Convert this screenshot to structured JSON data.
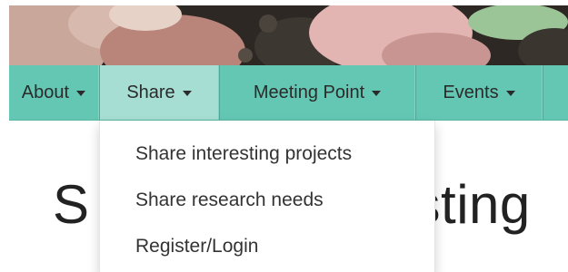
{
  "nav": {
    "items": [
      {
        "label": "About",
        "has_caret": true
      },
      {
        "label": "Share",
        "has_caret": true,
        "active": true
      },
      {
        "label": "Meeting Point",
        "has_caret": true
      },
      {
        "label": "Events",
        "has_caret": true
      }
    ],
    "background_color": "#63c7b3",
    "active_background_color": "#a6ded3"
  },
  "dropdown": {
    "items": [
      {
        "label": "Share interesting projects"
      },
      {
        "label": "Share research needs"
      },
      {
        "label": "Register/Login"
      }
    ]
  },
  "page": {
    "heading_visible_left": "S",
    "heading_visible_right": "sting"
  },
  "icons": {
    "caret": "caret-down-icon"
  }
}
